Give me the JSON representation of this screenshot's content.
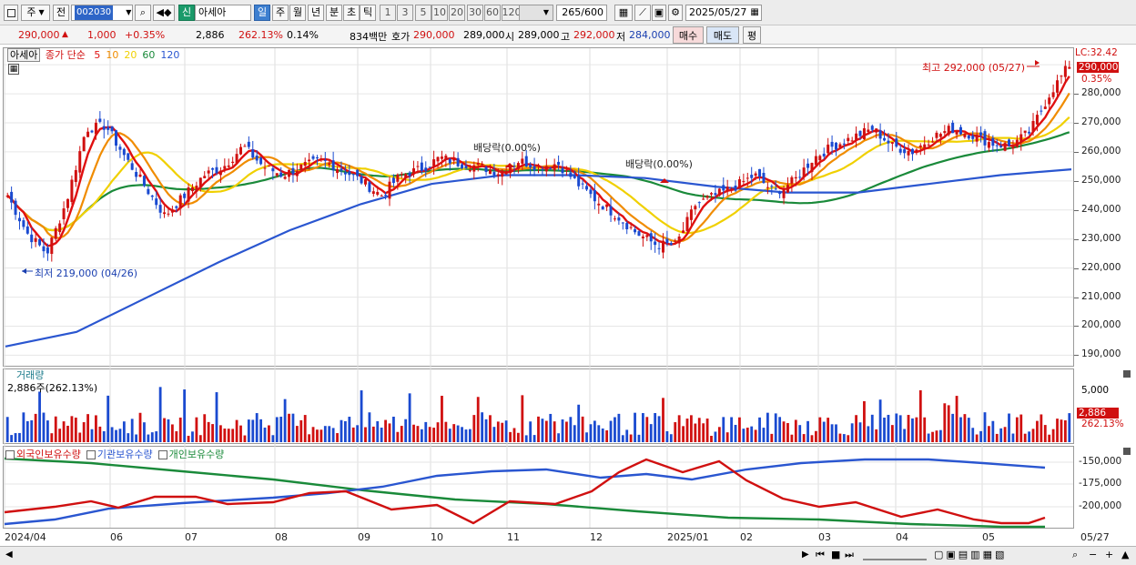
{
  "toolbar": {
    "period_label": "주",
    "prev_label": "전",
    "code": "002030",
    "stock_badge": "신",
    "stock_name": "아세아",
    "tf": [
      "일",
      "주",
      "월",
      "년",
      "분",
      "초",
      "틱"
    ],
    "nums": [
      "1",
      "3",
      "5",
      "10",
      "20",
      "30",
      "60",
      "120"
    ],
    "count": "265",
    "total": "600",
    "date": "2025/05/27"
  },
  "quote": {
    "price": "290,000",
    "change": "1,000",
    "rate": "+0.35%",
    "volume": "2,886",
    "vol_ratio": "262.13%",
    "turnover": "0.14%",
    "amount": "834백만",
    "hoga_label": "호가",
    "hoga": "290,000",
    "ask": "289,000",
    "open_label": "시",
    "open": "289,000",
    "high_label": "고",
    "high": "292,000",
    "low_label": "저",
    "low": "284,000",
    "buy": "매수",
    "sell": "매도",
    "eval": "평"
  },
  "price_panel": {
    "name": "아세아",
    "legend_title": "종가 단순",
    "ma": [
      {
        "label": "5",
        "color": "#e01010"
      },
      {
        "label": "10",
        "color": "#f08c00"
      },
      {
        "label": "20",
        "color": "#f0d000"
      },
      {
        "label": "60",
        "color": "#1a8a3a"
      },
      {
        "label": "120",
        "color": "#2a56d0"
      }
    ],
    "lc": "LC:32.42",
    "last_price": "290,000",
    "last_rate": "0.35%",
    "high_note": "최고 292,000 (05/27)",
    "low_note": "최저 219,000 (04/26)",
    "div_note1": "배당락(0.00%)",
    "div_note2": "배당락(0.00%)"
  },
  "volume_panel": {
    "title": "거래량",
    "value": "2,886주(262.13%)",
    "last": "2,886",
    "last_rate": "262.13%",
    "axis": "5,000"
  },
  "holding_panel": {
    "legend": [
      "외국인보유수량",
      "기관보유수량",
      "개인보유수량"
    ],
    "colors": [
      "#d01010",
      "#2a56d0",
      "#1a8a3a"
    ],
    "axis": [
      "-150,000",
      "-175,000",
      "-200,000"
    ]
  },
  "x_axis": [
    "2024/04",
    "06",
    "07",
    "08",
    "09",
    "10",
    "11",
    "12",
    "2025/01",
    "02",
    "03",
    "04",
    "05",
    "05/27"
  ],
  "chart_data": {
    "type": "candlestick",
    "x_start": "2024/04",
    "x_end": "2025/05/27",
    "y_axis": [
      "290,000",
      "280,000",
      "270,000",
      "260,000",
      "250,000",
      "240,000",
      "230,000",
      "220,000",
      "210,000",
      "200,000",
      "190,000"
    ],
    "ylim": [
      187000,
      296000
    ],
    "close_path": [
      245000,
      232000,
      225000,
      243000,
      268000,
      269000,
      258000,
      248000,
      238000,
      245000,
      252000,
      255000,
      262000,
      255000,
      252000,
      255000,
      257000,
      254000,
      250000,
      245000,
      252000,
      254000,
      258000,
      256000,
      255000,
      253000,
      257000,
      255000,
      256000,
      249000,
      243000,
      238000,
      232000,
      228000,
      228000,
      242000,
      245000,
      248000,
      252000,
      246000,
      250000,
      258000,
      262000,
      265000,
      268000,
      262000,
      260000,
      265000,
      268000,
      266000,
      263000,
      262000,
      267000,
      280000,
      290000
    ],
    "ma120": [
      193000,
      198000,
      210000,
      222000,
      233000,
      242000,
      249000,
      252000,
      252000,
      251000,
      248000,
      246000,
      246000,
      249000,
      252000,
      254000
    ],
    "volume_scale_note": "bars relative to 5,000"
  }
}
